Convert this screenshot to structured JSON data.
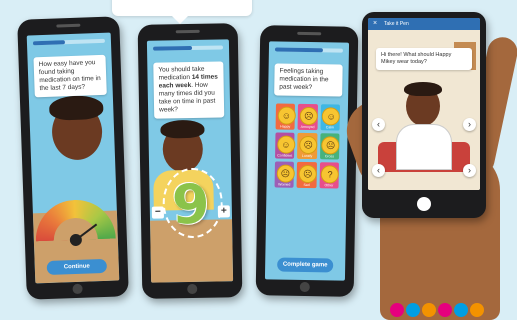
{
  "phone1": {
    "question": "How easy have you found taking medication on time in the last 7 days?",
    "button": "Continue",
    "progress_fraction": 0.45
  },
  "phone2": {
    "question_part1": "You should take medication",
    "question_bold": "14 times each week",
    "question_part2": ". How many times did you take on time in past week?",
    "number": "9",
    "minus": "−",
    "plus": "+",
    "progress_fraction": 0.55
  },
  "phone3": {
    "question": "Feelings taking medication in the past week?",
    "button": "Complete game",
    "progress_fraction": 0.7,
    "tiles": [
      {
        "label": "Happy",
        "color": "#f26a3f",
        "face": "☺"
      },
      {
        "label": "Annoyed",
        "color": "#e84f8a",
        "face": "☹"
      },
      {
        "label": "Calm",
        "color": "#3eb7e4",
        "face": "☺"
      },
      {
        "label": "Confident",
        "color": "#b44fa0",
        "face": "☺"
      },
      {
        "label": "Lonely",
        "color": "#f09a37",
        "face": "☹"
      },
      {
        "label": "Cross",
        "color": "#47b27c",
        "face": "☹"
      },
      {
        "label": "Worried",
        "color": "#9d5fb5",
        "face": "☹"
      },
      {
        "label": "Sad",
        "color": "#f26a3f",
        "face": "☹"
      },
      {
        "label": "Other",
        "color": "#e84f8a",
        "face": "?"
      }
    ]
  },
  "phone4": {
    "appbar_title": "Take it Pen",
    "close": "×",
    "question": "Hi there! What should Happy Mikey wear today?",
    "left": "‹",
    "right": "›"
  },
  "brand_dots": [
    "#e6007e",
    "#009ee3",
    "#f39200",
    "#e6007e",
    "#009ee3",
    "#f39200"
  ]
}
